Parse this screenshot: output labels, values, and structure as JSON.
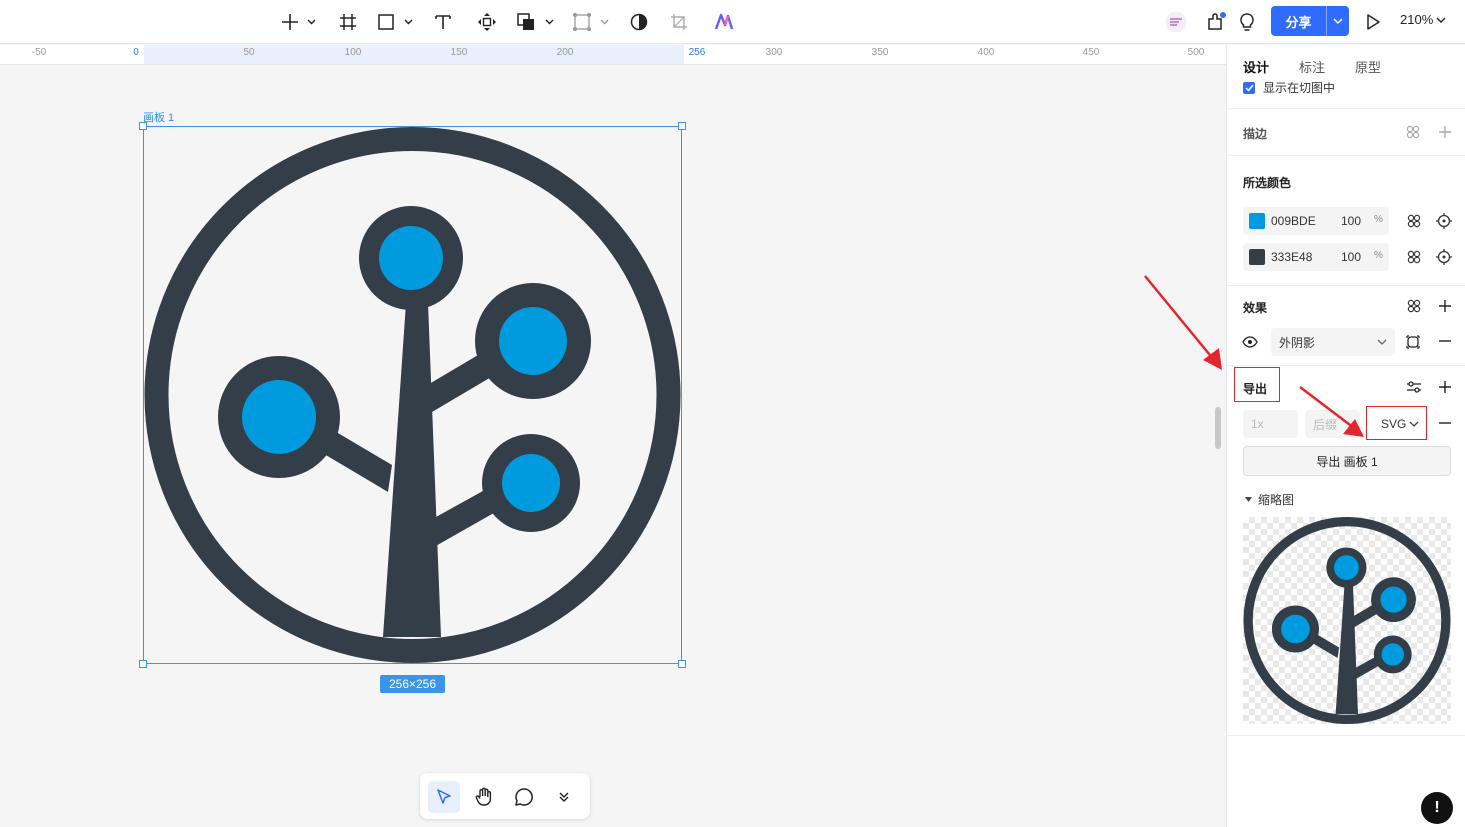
{
  "toolbar": {
    "share_label": "分享",
    "zoom_label": "210%"
  },
  "ruler": {
    "ticks": [
      "-50",
      "0",
      "50",
      "100",
      "150",
      "200",
      "256",
      "300",
      "350",
      "400",
      "450",
      "500"
    ]
  },
  "canvas": {
    "frame_label": "画板 1",
    "size_label": "256×256",
    "icon_colors": {
      "primary": "#009BDE",
      "dark": "#333E48"
    }
  },
  "panel": {
    "tabs": [
      "设计",
      "标注",
      "原型"
    ],
    "show_in_slice": "显示在切图中",
    "stroke_title": "描边",
    "selected_colors_title": "所选颜色",
    "colors": [
      {
        "hex": "009BDE",
        "swatch": "#009BDE",
        "opacity": "100",
        "unit": "%"
      },
      {
        "hex": "333E48",
        "swatch": "#333E48",
        "opacity": "100",
        "unit": "%"
      }
    ],
    "effects_title": "效果",
    "effect_type": "外阴影",
    "export_title": "导出",
    "scale_placeholder": "1x",
    "suffix_placeholder": "后缀",
    "format": "SVG",
    "export_button": "导出 画板 1",
    "thumbnail_label": "缩略图"
  },
  "help_label": "!"
}
